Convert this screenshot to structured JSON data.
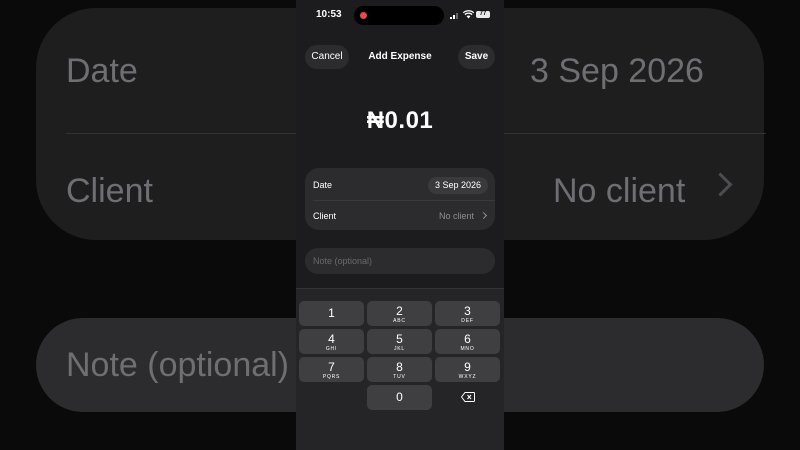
{
  "background": {
    "date_label": "Date",
    "date_value": "3 Sep 2026",
    "client_label": "Client",
    "client_value": "No client",
    "note_placeholder": "Note (optional)"
  },
  "status_bar": {
    "time": "10:53",
    "battery": "77"
  },
  "header": {
    "cancel_label": "Cancel",
    "title": "Add Expense",
    "save_label": "Save"
  },
  "amount": "₦0.01",
  "form": {
    "date_label": "Date",
    "date_value": "3 Sep 2026",
    "client_label": "Client",
    "client_value": "No client",
    "note_placeholder": "Note (optional)"
  },
  "keypad": {
    "keys": [
      {
        "num": "1",
        "letters": ""
      },
      {
        "num": "2",
        "letters": "ABC"
      },
      {
        "num": "3",
        "letters": "DEF"
      },
      {
        "num": "4",
        "letters": "GHI"
      },
      {
        "num": "5",
        "letters": "JKL"
      },
      {
        "num": "6",
        "letters": "MNO"
      },
      {
        "num": "7",
        "letters": "PQRS"
      },
      {
        "num": "8",
        "letters": "TUV"
      },
      {
        "num": "9",
        "letters": "WXYZ"
      },
      {
        "num": "0",
        "letters": ""
      }
    ]
  },
  "colors": {
    "background": "#0a0a0a",
    "surface": "#1c1c1e",
    "card": "#2c2c2e",
    "key": "#3f3f42",
    "recording": "#e5484d"
  }
}
